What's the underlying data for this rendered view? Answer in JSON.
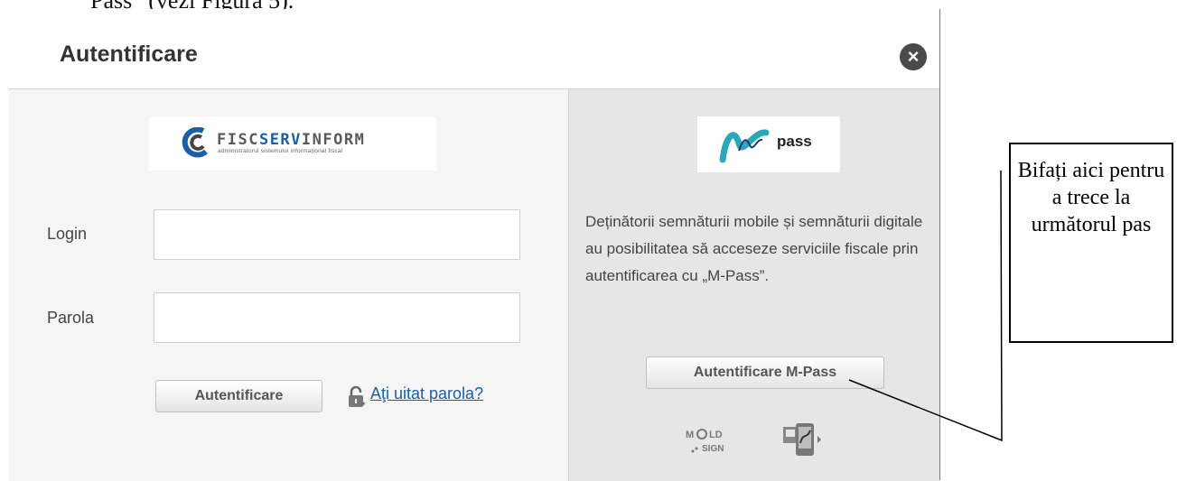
{
  "document": {
    "partial_text": "Pass” (vezi Figura 5)."
  },
  "dialog": {
    "title": "Autentificare",
    "close_symbol": "×"
  },
  "left_panel": {
    "logo": {
      "name_plain": "FISC",
      "name_highlight": "SERV",
      "name_rest": "INFORM",
      "tagline": "administratorul sistemului informaţional fiscal"
    },
    "login_label": "Login",
    "login_value": "",
    "password_label": "Parola",
    "password_value": "",
    "login_button": "Autentificare",
    "forgot_link": "Aţi uitat parola?",
    "icons": {
      "logo": "fiscservinform-logo",
      "forgot": "lock-icon"
    }
  },
  "right_panel": {
    "logo_text": "pass",
    "description": "Deținătorii semnăturii mobile și semnăturii digitale au posibilitatea să acceseze serviciile fiscale prin autentificarea cu „M-Pass”.",
    "button": "Autentificare M-Pass",
    "icons": [
      "moldsign-icon",
      "mobile-signature-icon"
    ]
  },
  "callout": {
    "text": "Bifați aici pentru a trece la următorul pas"
  },
  "colors": {
    "link": "#1a5fa8",
    "left_panel_bg": "#f5f5f5",
    "right_panel_bg": "#e6e6e6",
    "close_button": "#4a4a4a",
    "mpass_teal": "#2aa8b8"
  }
}
